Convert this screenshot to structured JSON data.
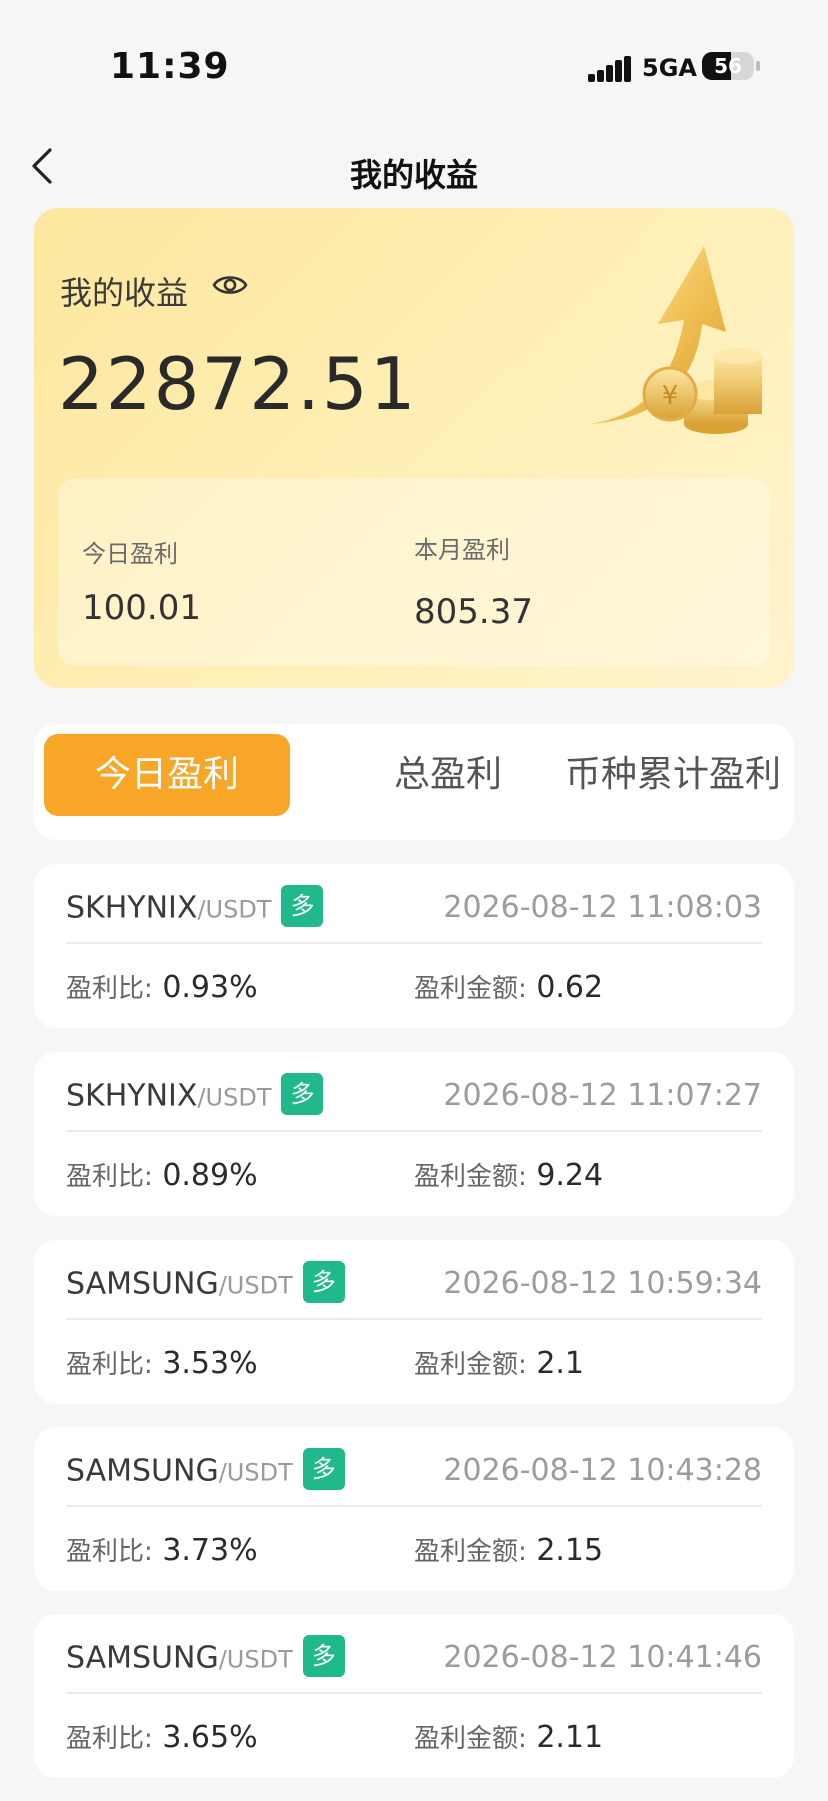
{
  "status_bar": {
    "time": "11:39",
    "network": "5GA",
    "battery": "56",
    "battery_level": 0.56
  },
  "nav": {
    "title": "我的收益"
  },
  "summary": {
    "label": "我的收益",
    "total": "22872.51",
    "today_label": "今日盈利",
    "today_value": "100.01",
    "month_label": "本月盈利",
    "month_value": "805.37"
  },
  "tabs": [
    {
      "label": "今日盈利",
      "active": true
    },
    {
      "label": "总盈利",
      "active": false
    },
    {
      "label": "币种累计盈利",
      "active": false
    }
  ],
  "records": [
    {
      "symbol": "SKHYNIX",
      "quote": "/USDT",
      "direction": "多",
      "time": "2026-08-12 11:08:03",
      "ratio_label": "盈利比:",
      "ratio": "0.93%",
      "amount_label": "盈利金额:",
      "amount": "0.62"
    },
    {
      "symbol": "SKHYNIX",
      "quote": "/USDT",
      "direction": "多",
      "time": "2026-08-12 11:07:27",
      "ratio_label": "盈利比:",
      "ratio": "0.89%",
      "amount_label": "盈利金额:",
      "amount": "9.24"
    },
    {
      "symbol": "SAMSUNG",
      "quote": "/USDT",
      "direction": "多",
      "time": "2026-08-12 10:59:34",
      "ratio_label": "盈利比:",
      "ratio": "3.53%",
      "amount_label": "盈利金额:",
      "amount": "2.1"
    },
    {
      "symbol": "SAMSUNG",
      "quote": "/USDT",
      "direction": "多",
      "time": "2026-08-12 10:43:28",
      "ratio_label": "盈利比:",
      "ratio": "3.73%",
      "amount_label": "盈利金额:",
      "amount": "2.15"
    },
    {
      "symbol": "SAMSUNG",
      "quote": "/USDT",
      "direction": "多",
      "time": "2026-08-12 10:41:46",
      "ratio_label": "盈利比:",
      "ratio": "3.65%",
      "amount_label": "盈利金额:",
      "amount": "2.11"
    }
  ],
  "icons": {
    "back": "chevron-left-icon",
    "eye": "eye-icon",
    "art": "arrow-coins-icon"
  },
  "colors": {
    "accent": "#f8a628",
    "long_badge": "#1fb98b",
    "card_gold": "#fde79e"
  }
}
